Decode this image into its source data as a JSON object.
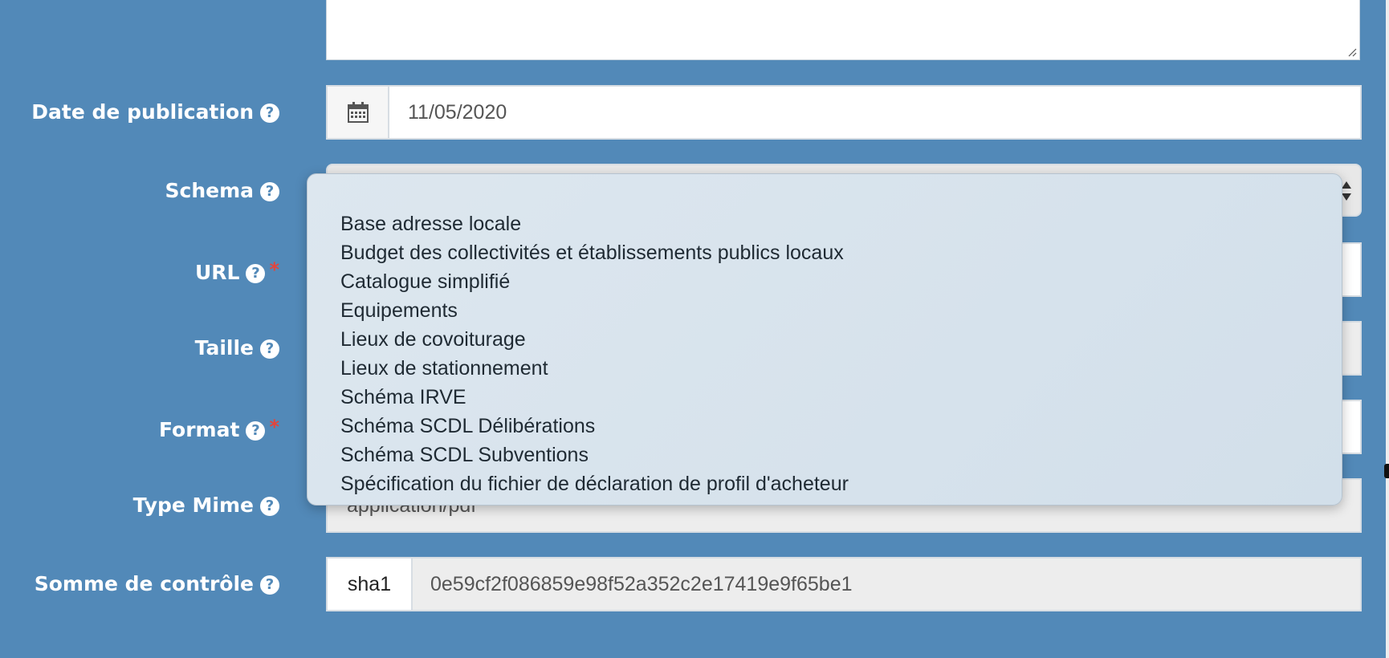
{
  "fields": {
    "description": {
      "value": ""
    },
    "publication_date": {
      "label": "Date de publication",
      "value": "11/05/2020",
      "icon": "calendar-icon"
    },
    "schema": {
      "label": "Schema",
      "value": ""
    },
    "url": {
      "label": "URL",
      "required": "*",
      "value": ""
    },
    "size": {
      "label": "Taille",
      "value": ""
    },
    "format": {
      "label": "Format",
      "required": "*",
      "value": ""
    },
    "mime": {
      "label": "Type Mime",
      "value": "application/pdf"
    },
    "checksum": {
      "label": "Somme de contrôle",
      "type": "sha1",
      "value": "0e59cf2f086859e98f52a352c2e17419e9f65be1"
    }
  },
  "help_glyph": "?",
  "schema_dropdown": {
    "options": [
      "Base adresse locale",
      "Budget des collectivités et établissements publics locaux",
      "Catalogue simplifié",
      "Equipements",
      "Lieux de covoiturage",
      "Lieux de stationnement",
      "Schéma IRVE",
      "Schéma SCDL Délibérations",
      "Schéma SCDL Subventions",
      "Spécification du fichier de déclaration de profil d'acheteur"
    ]
  },
  "colors": {
    "background": "#5289b8",
    "required": "#e2453d",
    "field_readonly": "#ededed",
    "dropdown": "#d8e4ee"
  }
}
